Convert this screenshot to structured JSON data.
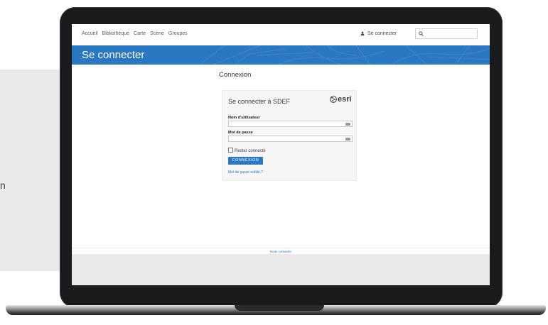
{
  "page_edge_text": "n",
  "nav": {
    "items": [
      "Accueil",
      "Bibliothèque",
      "Carte",
      "Scène",
      "Groupes"
    ],
    "signin": "Se connecter",
    "search_placeholder": ""
  },
  "banner": {
    "title": "Se connecter"
  },
  "main": {
    "heading": "Connexion",
    "card": {
      "title": "Se connecter à SDEF",
      "brand": "esri",
      "username_label": "Nom d'utilisateur",
      "username_value": "",
      "password_label": "Mot de passe",
      "password_value": "",
      "remember_label": "Rester connecté",
      "submit_label": "CONNEXION",
      "forgot_label": "Mot de passe oublié ?"
    }
  },
  "footer": {
    "contact": "Nous contacter"
  },
  "colors": {
    "accent": "#2a78c2",
    "laptop_bezel": "#1b1b1d",
    "panel_gray": "#e9e9ea"
  },
  "icons": [
    "person-icon",
    "search-icon",
    "esri-globe-icon",
    "keyboard-icon"
  ]
}
